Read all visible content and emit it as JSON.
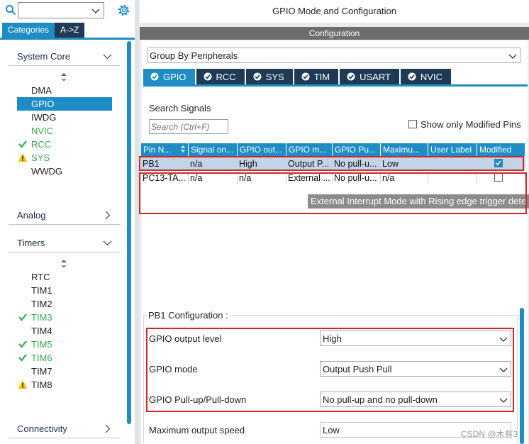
{
  "left_panel": {
    "tabs": [
      "Categories",
      "A->Z"
    ],
    "categories": [
      {
        "label": "System Core",
        "expanded": true
      },
      {
        "label": "Analog",
        "expanded": false
      },
      {
        "label": "Timers",
        "expanded": true
      },
      {
        "label": "Connectivity",
        "expanded": false
      }
    ],
    "system_core_items": [
      {
        "label": "DMA",
        "status": "none"
      },
      {
        "label": "GPIO",
        "status": "selected"
      },
      {
        "label": "IWDG",
        "status": "none"
      },
      {
        "label": "NVIC",
        "status": "enabled"
      },
      {
        "label": "RCC",
        "status": "check"
      },
      {
        "label": "SYS",
        "status": "warning"
      },
      {
        "label": "WWDG",
        "status": "none"
      }
    ],
    "timers_items": [
      {
        "label": "RTC",
        "status": "none"
      },
      {
        "label": "TIM1",
        "status": "none"
      },
      {
        "label": "TIM2",
        "status": "none"
      },
      {
        "label": "TIM3",
        "status": "check"
      },
      {
        "label": "TIM4",
        "status": "none"
      },
      {
        "label": "TIM5",
        "status": "check"
      },
      {
        "label": "TIM6",
        "status": "check"
      },
      {
        "label": "TIM7",
        "status": "none"
      },
      {
        "label": "TIM8",
        "status": "warning"
      }
    ]
  },
  "header": {
    "title": "GPIO Mode and Configuration",
    "config_bar": "Configuration"
  },
  "group_by": {
    "value": "Group By Peripherals"
  },
  "peripheral_tabs": [
    "GPIO",
    "RCC",
    "SYS",
    "TIM",
    "USART",
    "NVIC"
  ],
  "search": {
    "label": "Search Signals",
    "placeholder": "Search (Ctrl+F)",
    "show_modified_label": "Show only Modified Pins",
    "show_modified_checked": false
  },
  "table": {
    "columns": [
      "Pin N...",
      "Signal on...",
      "GPIO out...",
      "GPIO m...",
      "GPIO Pu...",
      "Maximu...",
      "User Label",
      "Modified"
    ],
    "rows": [
      {
        "cells": [
          "PB1",
          "n/a",
          "High",
          "Output P...",
          "No pull-u...",
          "Low",
          ""
        ],
        "modified": true,
        "selected": true
      },
      {
        "cells": [
          "PC13-TA...",
          "n/a",
          "n/a",
          "External ...",
          "No pull-u...",
          "n/a",
          ""
        ],
        "modified": false,
        "selected": false
      }
    ]
  },
  "tooltip": "External Interrupt Mode with Rising edge trigger dete",
  "pb1_config": {
    "title": "PB1 Configuration :",
    "fields": [
      {
        "label": "GPIO output level",
        "value": "High"
      },
      {
        "label": "GPIO mode",
        "value": "Output Push Pull"
      },
      {
        "label": "GPIO Pull-up/Pull-down",
        "value": "No pull-up and no pull-down"
      },
      {
        "label": "Maximum output speed",
        "value": "Low"
      }
    ]
  },
  "watermark": "CSDN @木有3",
  "colors": {
    "accent": "#1e8dc6",
    "dark_tab": "#1f3a55",
    "green": "#3ca94f",
    "warning": "#f2c200",
    "highlight_box": "#cc2a2a"
  }
}
